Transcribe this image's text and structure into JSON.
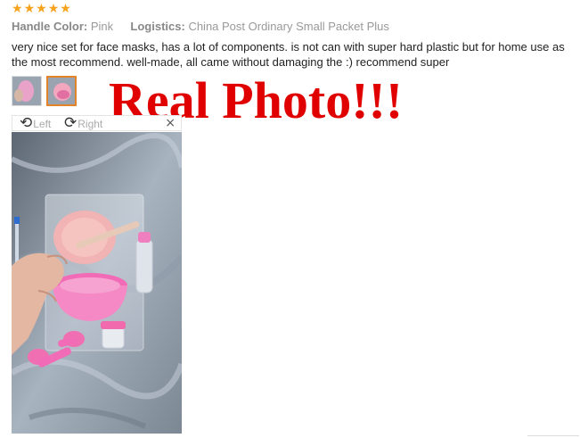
{
  "review": {
    "rating": 5,
    "handle_color_label": "Handle Color:",
    "handle_color_value": "Pink",
    "logistics_label": "Logistics:",
    "logistics_value": "China Post Ordinary Small Packet Plus",
    "text": "very nice set for face masks, has a lot of components. is not can with super hard plastic but for home use as the most recommend. well-made, all came without damaging the :) recommend super"
  },
  "banner": {
    "text": "Real Photo!!!",
    "color": "#e00000"
  },
  "viewer": {
    "rotate_left_label": "Left",
    "rotate_right_label": "Right",
    "close_icon": "×",
    "photo_alt": "pink face mask kit"
  },
  "colors": {
    "star": "#f7a21b",
    "active_thumb_border": "#e3842a"
  }
}
